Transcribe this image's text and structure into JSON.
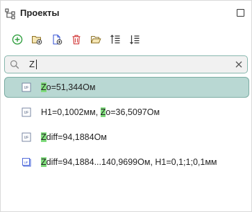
{
  "header": {
    "title": "Проекты",
    "tree_icon": "project-tree-icon",
    "maximize_icon": "maximize-icon"
  },
  "toolbar": {
    "buttons": [
      {
        "name": "add-button",
        "icon": "plus-circle-icon",
        "color": "#2e9e3d"
      },
      {
        "name": "new-folder-button",
        "icon": "folder-add-icon"
      },
      {
        "name": "new-file-button",
        "icon": "file-add-icon",
        "color": "#3f5bd6"
      },
      {
        "name": "delete-button",
        "icon": "trash-icon",
        "color": "#d23a3a"
      },
      {
        "name": "open-folder-button",
        "icon": "folder-open-icon"
      },
      {
        "name": "sort-ascending-button",
        "icon": "sort-ascending-icon"
      },
      {
        "name": "sort-descending-button",
        "icon": "sort-descending-icon"
      }
    ]
  },
  "search": {
    "value": "Z",
    "search_icon": "magnifier-icon",
    "clear_icon": "close-icon"
  },
  "results": [
    {
      "icon": "uf-file-icon",
      "selected": true,
      "parts": [
        {
          "t": "Z",
          "hl": true
        },
        {
          "t": "o=51,344Ом",
          "hl": false
        }
      ]
    },
    {
      "icon": "uf-file-icon",
      "selected": false,
      "parts": [
        {
          "t": "H1=0,1002мм, ",
          "hl": false
        },
        {
          "t": "Z",
          "hl": true
        },
        {
          "t": "o=36,5097Ом",
          "hl": false
        }
      ]
    },
    {
      "icon": "uf-file-icon",
      "selected": false,
      "parts": [
        {
          "t": "Z",
          "hl": true
        },
        {
          "t": "diff=94,1884Ом",
          "hl": false
        }
      ]
    },
    {
      "icon": "uf-sweep-icon",
      "selected": false,
      "parts": [
        {
          "t": "Z",
          "hl": true
        },
        {
          "t": "diff=94,1884...140,9699Ом, H1=0,1;1;0,1мм",
          "hl": false
        }
      ]
    }
  ],
  "colors": {
    "accent": "#7aaba2",
    "selection": "#b9d8d3",
    "highlight": "#7fdc7c"
  }
}
